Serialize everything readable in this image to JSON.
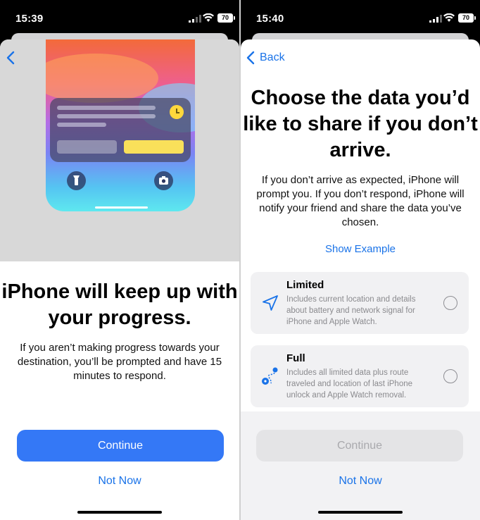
{
  "left": {
    "status": {
      "time": "15:39",
      "battery": "70"
    },
    "title": "iPhone will keep up with your progress.",
    "body": "If you aren’t making progress towards your destination, you’ll be prompted and have 15 minutes to respond.",
    "continue_label": "Continue",
    "not_now_label": "Not Now"
  },
  "right": {
    "status": {
      "time": "15:40",
      "battery": "70"
    },
    "back_label": "Back",
    "title": "Choose the data you’d like to share if you don’t arrive.",
    "body": "If you don’t arrive as expected, iPhone will prompt you. If you don’t respond, iPhone will notify your friend and share the data you’ve chosen.",
    "show_example_label": "Show Example",
    "options": [
      {
        "title": "Limited",
        "description": "Includes current location and details about battery and network signal for iPhone and Apple Watch.",
        "icon": "location-arrow-icon",
        "selected": false
      },
      {
        "title": "Full",
        "description": "Includes all limited data plus route traveled and location of last iPhone unlock and Apple Watch removal.",
        "icon": "route-icon",
        "selected": false
      }
    ],
    "continue_label": "Continue",
    "continue_enabled": false,
    "not_now_label": "Not Now"
  },
  "colors": {
    "accent": "#1a73e8",
    "button_blue": "#3478f6",
    "disabled_button": "#e4e4e6"
  }
}
